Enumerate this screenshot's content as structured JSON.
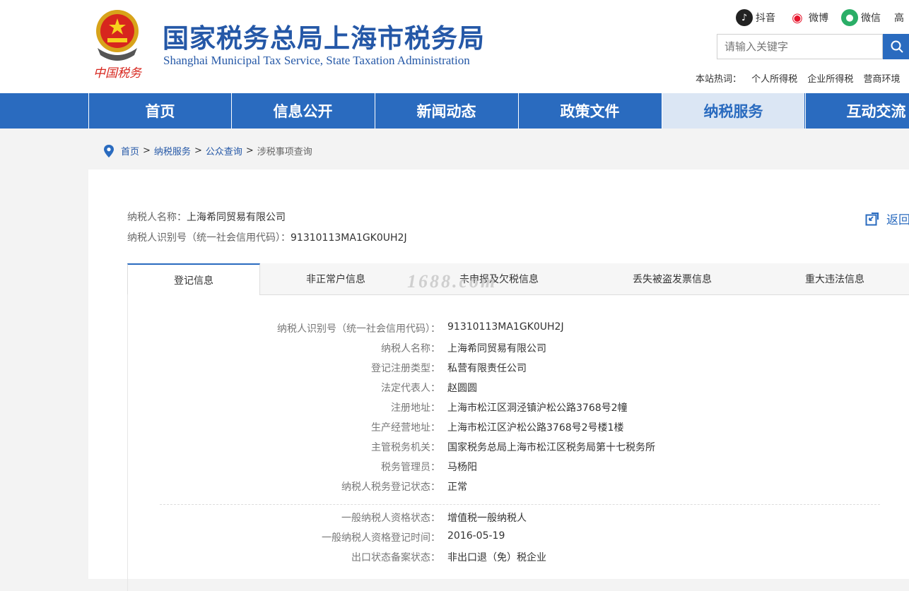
{
  "header": {
    "title_cn": "国家税务总局上海市税务局",
    "title_en": "Shanghai Municipal Tax Service, State Taxation Administration",
    "emblem_text": "中国税务",
    "social": [
      {
        "label": "抖音",
        "icon": "douyin-icon",
        "color": "#222222"
      },
      {
        "label": "微博",
        "icon": "weibo-icon",
        "color": "#e6162d"
      },
      {
        "label": "微信",
        "icon": "wechat-icon",
        "color": "#2aae67"
      },
      {
        "label": "高"
      }
    ],
    "search_placeholder": "请输入关键字",
    "hotwords_label": "本站热词：",
    "hotwords": [
      "个人所得税",
      "企业所得税",
      "营商环境"
    ]
  },
  "nav": {
    "items": [
      "首页",
      "信息公开",
      "新闻动态",
      "政策文件",
      "纳税服务",
      "互动交流"
    ],
    "active_index": 4
  },
  "breadcrumb": {
    "items": [
      "首页",
      "纳税服务",
      "公众查询",
      "涉税事项查询"
    ],
    "separator": ">"
  },
  "taxpayer": {
    "name_label": "纳税人名称：",
    "name": "上海希同贸易有限公司",
    "id_label": "纳税人识别号（统一社会信用代码）：",
    "id": "91310113MA1GK0UH2J",
    "back_label": "返回"
  },
  "tabs": {
    "items": [
      "登记信息",
      "非正常户信息",
      "未申报及欠税信息",
      "丢失被盗发票信息",
      "重大违法信息"
    ],
    "active_index": 0
  },
  "registration": {
    "rows": [
      {
        "key": "纳税人识别号（统一社会信用代码）：",
        "value": "91310113MA1GK0UH2J"
      },
      {
        "key": "纳税人名称：",
        "value": "上海希同贸易有限公司"
      },
      {
        "key": "登记注册类型：",
        "value": "私营有限责任公司"
      },
      {
        "key": "法定代表人：",
        "value": "赵圆圆"
      },
      {
        "key": "注册地址：",
        "value": "上海市松江区洞泾镇沪松公路3768号2幢"
      },
      {
        "key": "生产经营地址：",
        "value": "上海市松江区沪松公路3768号2号楼1楼"
      },
      {
        "key": "主管税务机关：",
        "value": "国家税务总局上海市松江区税务局第十七税务所"
      },
      {
        "key": "税务管理员：",
        "value": "马杨阳"
      },
      {
        "key": "纳税人税务登记状态：",
        "value": "正常"
      }
    ],
    "rows2": [
      {
        "key": "一般纳税人资格状态：",
        "value": "增值税一般纳税人"
      },
      {
        "key": "一般纳税人资格登记时间：",
        "value": "2016-05-19"
      },
      {
        "key": "出口状态备案状态：",
        "value": "非出口退（免）税企业"
      }
    ]
  },
  "watermark": "1688.com",
  "colors": {
    "brand": "#2a6bbf",
    "title": "#2558a7"
  }
}
